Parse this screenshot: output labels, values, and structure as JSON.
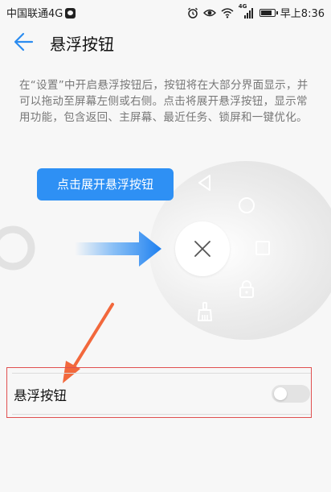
{
  "status_bar": {
    "carrier": "中国联通4G",
    "time": "早上8:36",
    "signal_label": "4G",
    "battery_level": 0.85,
    "icons": [
      "carrier-badge-icon",
      "alarm-icon",
      "eye-icon",
      "wifi-icon",
      "signal-icon",
      "battery-icon"
    ]
  },
  "header": {
    "back_icon": "back-arrow-icon",
    "title": "悬浮按钮"
  },
  "description": "在“设置”中开启悬浮按钮后，按钮将在大部分界面显示，并可以拖动至屏幕左侧或右侧。点击将展开悬浮按钮，显示常用功能，包含返回、主屏幕、最近任务、锁屏和一键优化。",
  "illustration": {
    "tooltip": "点击展开悬浮按钮",
    "menu_icons": [
      "back-triangle-icon",
      "home-circle-icon",
      "recents-square-icon",
      "lock-icon",
      "broom-icon",
      "close-x-icon"
    ],
    "accent_color": "#2e90f4",
    "annotation_color": "#f2683c"
  },
  "setting": {
    "label": "悬浮按钮",
    "enabled": false
  }
}
